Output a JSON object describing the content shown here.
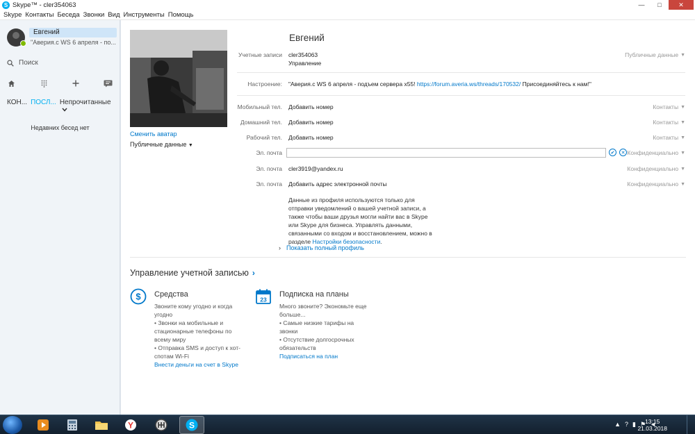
{
  "window": {
    "title": "Skype™ - cler354063",
    "controls": {
      "minimize": "—",
      "maximize": "□",
      "close": "✕"
    }
  },
  "menu": [
    "Skype",
    "Контакты",
    "Беседа",
    "Звонки",
    "Вид",
    "Инструменты",
    "Помощь"
  ],
  "sidebar": {
    "user": {
      "name": "Евгений",
      "mood": "\"Аверия.с WS 6 апреля - по...",
      "status": "online"
    },
    "search_label": "Поиск",
    "nav_icons": [
      "home-icon",
      "dialpad-icon",
      "add-contact-icon",
      "chat-icon"
    ],
    "tabs": [
      {
        "label": "КОН..."
      },
      {
        "label": "ПОСЛ...",
        "active": true
      },
      {
        "label": "Непрочитанные"
      }
    ],
    "empty_text": "Недавних бесед нет"
  },
  "profile": {
    "name": "Евгений",
    "change_avatar": "Сменить аватар",
    "public_data": "Публичные данные",
    "accounts": {
      "label": "Учетные записи",
      "value": "cler354063",
      "manage": "Управление",
      "privacy": "Публичные данные"
    },
    "mood": {
      "label": "Настроение:",
      "prefix": "\"Аверия.с WS 6 апреля - подъем сервера x55!",
      "link": "https://forum.averia.ws/threads/170532/",
      "suffix": "Присоединяйтесь к нам!\""
    },
    "phones": [
      {
        "label": "Мобильный тел.",
        "action": "Добавить номер",
        "privacy": "Контакты"
      },
      {
        "label": "Домашний тел.",
        "action": "Добавить номер",
        "privacy": "Контакты"
      },
      {
        "label": "Рабочий тел.",
        "action": "Добавить номер",
        "privacy": "Контакты"
      }
    ],
    "email_edit": {
      "label": "Эл. почта",
      "value": "",
      "privacy": "Конфиденциально"
    },
    "email_2": {
      "label": "Эл. почта",
      "value": "cler3919@yandex.ru",
      "privacy": "Конфиденциально"
    },
    "email_3": {
      "label": "Эл. почта",
      "action": "Добавить адрес электронной почты",
      "privacy": "Конфиденциально"
    },
    "note": {
      "text": "Данные из профиля используются только для отправки уведомлений о вашей учетной записи, а также чтобы ваши друзья могли найти вас в Skype или Skype для бизнеса. Управлять данными, связанными со входом и восстановлением, можно в разделе",
      "link": "Настройки безопасности",
      "end": "."
    },
    "show_full": "Показать полный профиль"
  },
  "account": {
    "title": "Управление учетной записью",
    "credit": {
      "title": "Средства",
      "lines": [
        "Звоните кому угодно и когда угодно",
        "• Звонки на мобильные и стационарные телефоны по всему миру",
        "• Отправка SMS и доступ к хот-спотам Wi-Fi"
      ],
      "link": "Внести деньги на счет в Skype"
    },
    "plans": {
      "title": "Подписка на планы",
      "calendar_day": "23",
      "lines": [
        "Много звоните? Экономьте еще больше...",
        "• Самые низкие тарифы на звонки",
        "• Отсутствие долгосрочных обязательств"
      ],
      "link": "Подписаться на план"
    }
  },
  "taskbar": {
    "time": "13:15",
    "date": "21.03.2018",
    "yandex": "Y",
    "colors": {
      "skype": "#00aff0",
      "link": "#0078ca",
      "online": "#7fba00",
      "yandex": "#e3342f"
    }
  }
}
